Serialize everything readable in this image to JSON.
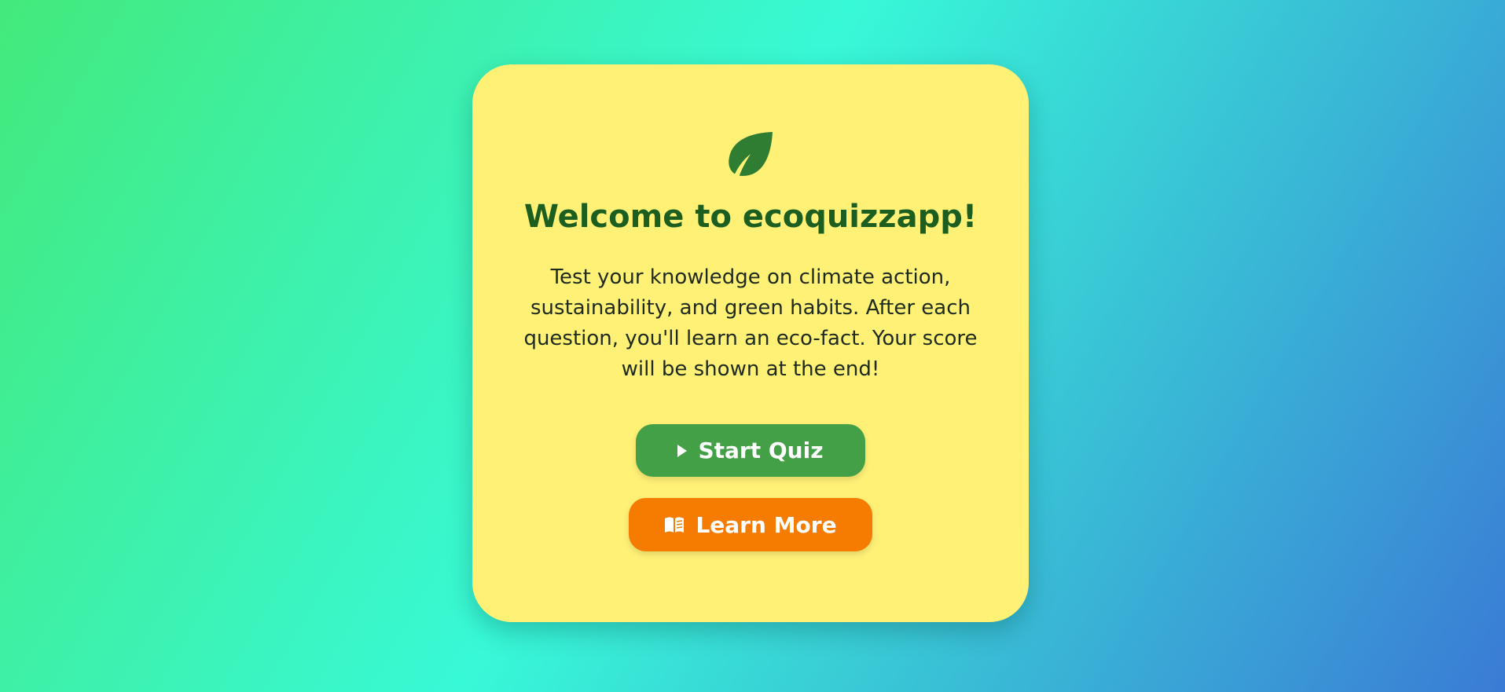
{
  "welcome": {
    "icon": "leaf-icon",
    "title": "Welcome to ecoquizzapp!",
    "description": "Test your knowledge on climate action, sustainability, and green habits. After each question, you'll learn an eco-fact. Your score will be shown at the end!"
  },
  "actions": {
    "start": {
      "label": "Start Quiz",
      "icon": "play-icon"
    },
    "learn": {
      "label": "Learn More",
      "icon": "book-icon"
    }
  },
  "colors": {
    "card": "#fff176",
    "title": "#1b5e20",
    "leaf": "#2e7d32",
    "start_button": "#43a047",
    "learn_button": "#f57c00"
  }
}
